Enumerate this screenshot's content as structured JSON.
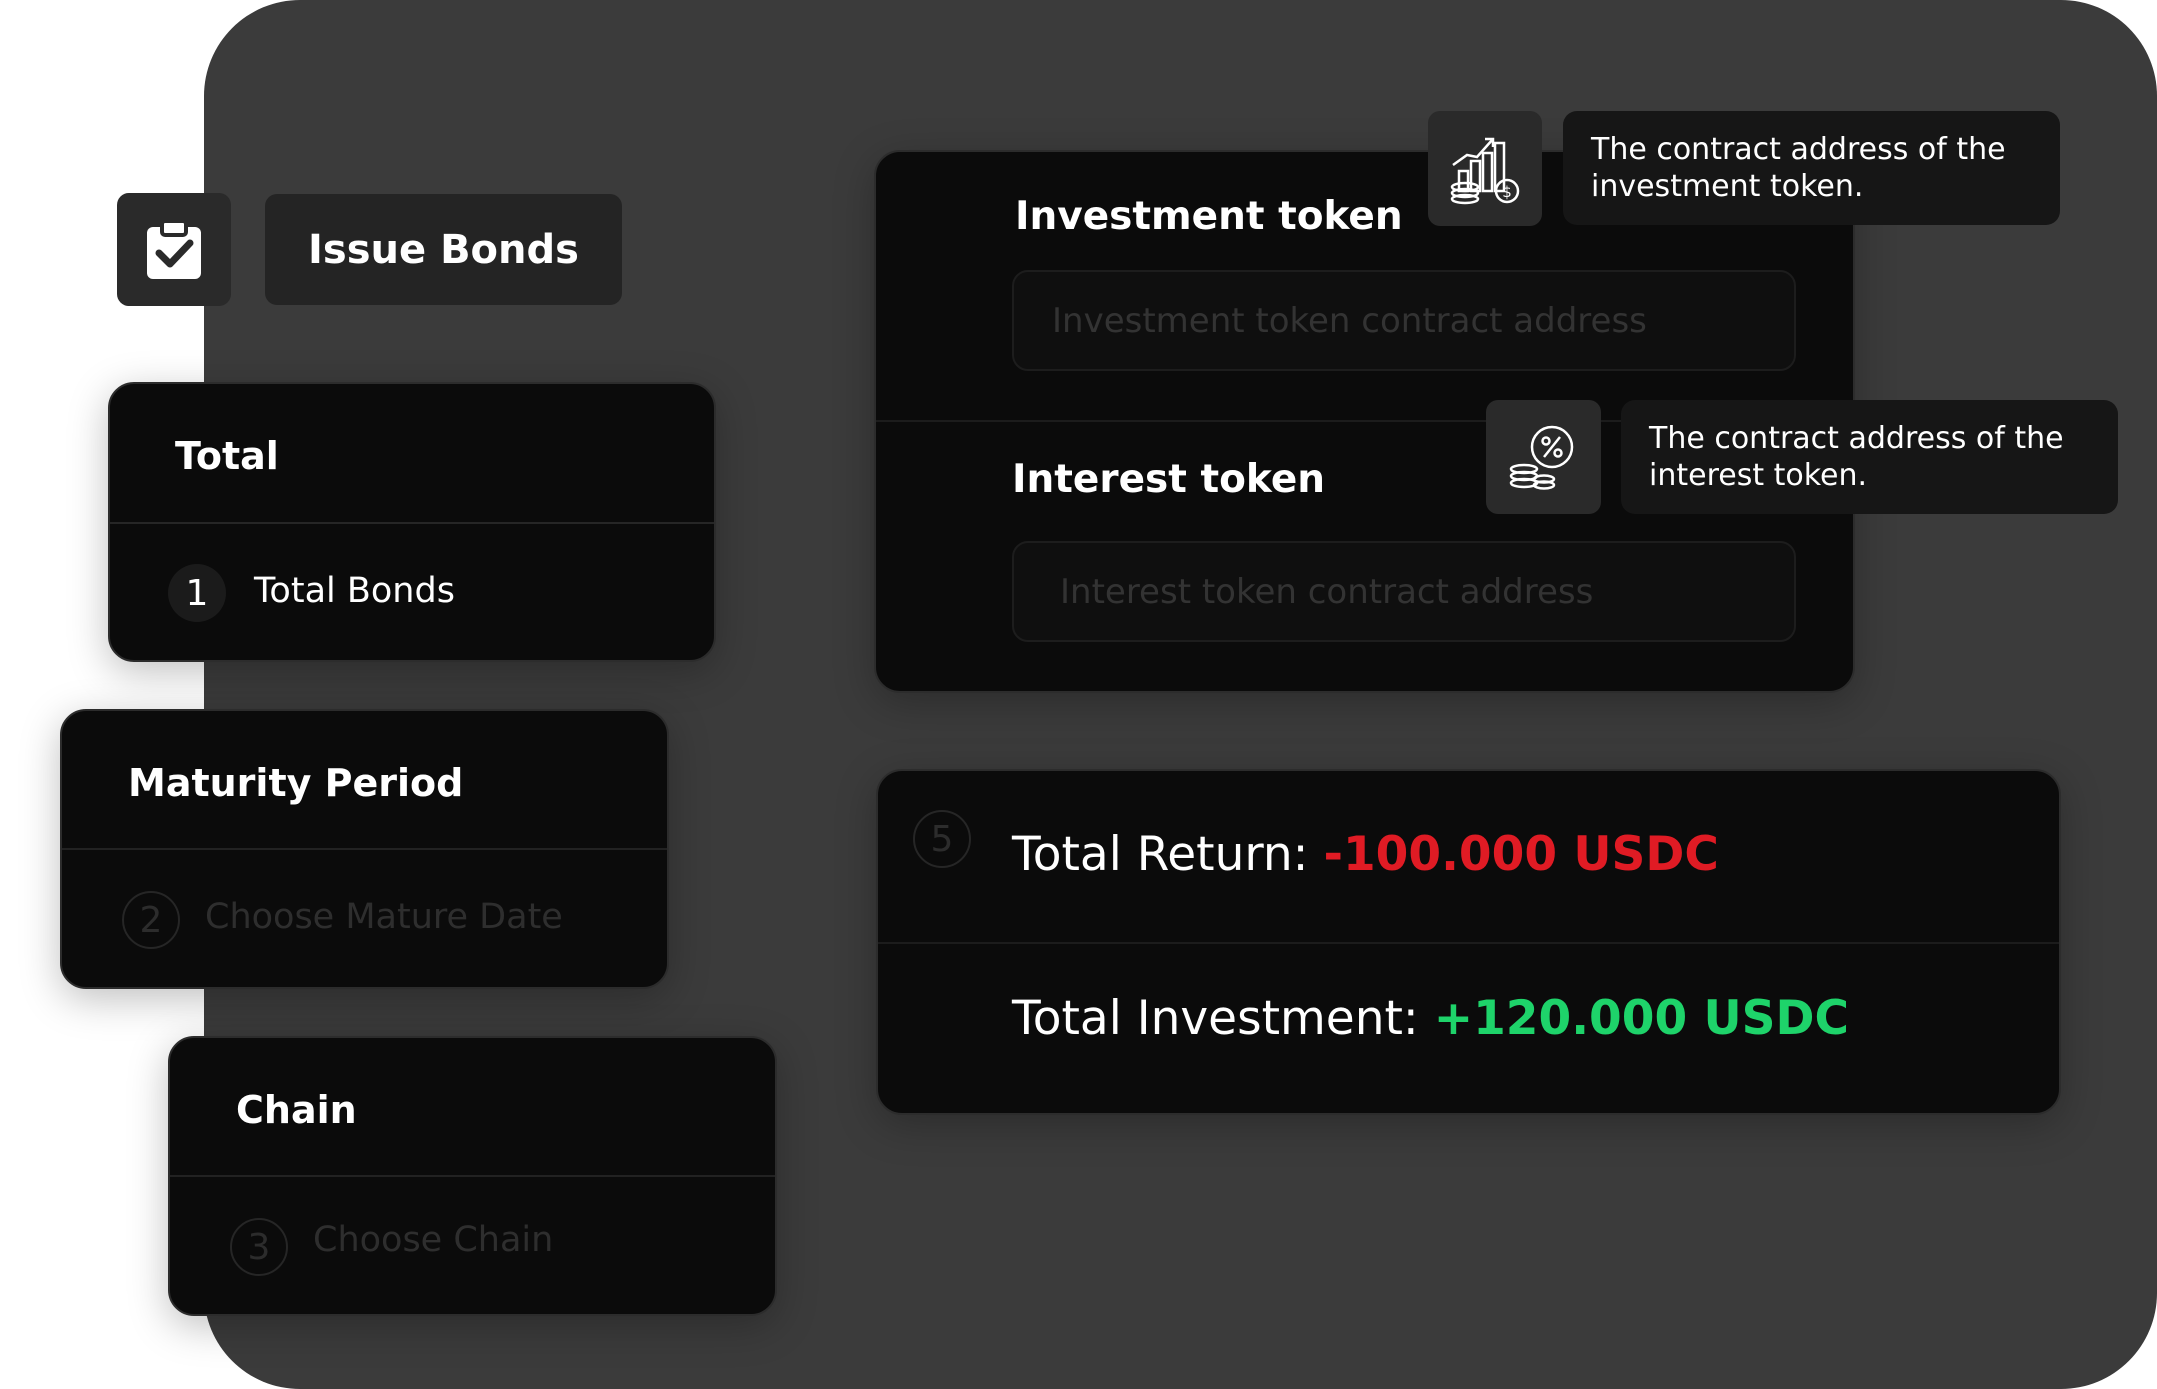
{
  "header": {
    "issue_button": "Issue Bonds"
  },
  "total_card": {
    "title": "Total",
    "step_number": "1",
    "label": "Total Bonds"
  },
  "maturity_card": {
    "title": "Maturity Period",
    "step_number": "2",
    "placeholder": "Choose Mature Date"
  },
  "chain_card": {
    "title": "Chain",
    "step_number": "3",
    "placeholder": "Choose Chain"
  },
  "token_card": {
    "investment_title": "Investment token",
    "investment_placeholder": "Investment token contract address",
    "interest_title": "Interest token",
    "interest_placeholder": "Interest token contract address"
  },
  "tooltips": {
    "investment": "The contract address of the investment token.",
    "interest": "The contract address of the interest token."
  },
  "icons": {
    "issue": "clipboard-check-icon",
    "investment": "growth-chart-coins-icon",
    "interest": "percent-coins-icon"
  },
  "summary_card": {
    "step_number": "5",
    "return_label": "Total Return: ",
    "return_value": "-100.000 USDC",
    "investment_label": "Total Investment: ",
    "investment_value": "+120.000 USDC"
  },
  "colors": {
    "negative": "#e01b24",
    "positive": "#1ed36a",
    "stage": "#3b3b3b",
    "card": "#0b0b0b"
  }
}
